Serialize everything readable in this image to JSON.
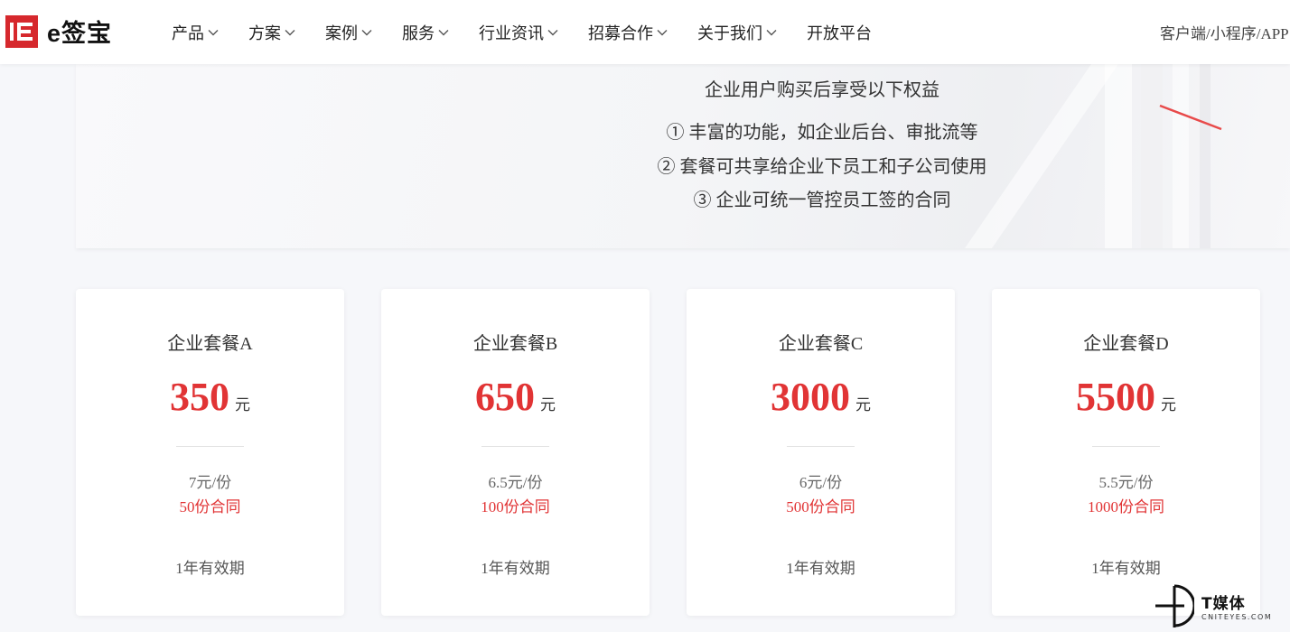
{
  "header": {
    "logo_text": "e签宝",
    "nav": [
      "产品",
      "方案",
      "案例",
      "服务",
      "行业资讯",
      "招募合作",
      "关于我们",
      "开放平台"
    ],
    "client_link": "客户端/小程序/APP"
  },
  "hero": {
    "subtitle": "企业用户购买后享受以下权益",
    "benefits": [
      "① 丰富的功能，如企业后台、审批流等",
      "② 套餐可共享给企业下员工和子公司使用",
      "③ 企业可统一管控员工签的合同"
    ]
  },
  "plans": [
    {
      "name": "企业套餐A",
      "price": "350",
      "unit": "元",
      "per_copy": "7元/份",
      "contracts": "50份合同",
      "validity": "1年有效期"
    },
    {
      "name": "企业套餐B",
      "price": "650",
      "unit": "元",
      "per_copy": "6.5元/份",
      "contracts": "100份合同",
      "validity": "1年有效期"
    },
    {
      "name": "企业套餐C",
      "price": "3000",
      "unit": "元",
      "per_copy": "6元/份",
      "contracts": "500份合同",
      "validity": "1年有效期"
    },
    {
      "name": "企业套餐D",
      "price": "5500",
      "unit": "元",
      "per_copy": "5.5元/份",
      "contracts": "1000份合同",
      "validity": "1年有效期"
    }
  ],
  "watermark": {
    "cn": "T媒体",
    "en": "CNITEYES.COM"
  },
  "colors": {
    "brand": "#d6282d",
    "price": "#e13435",
    "background": "#f6f7fa"
  }
}
